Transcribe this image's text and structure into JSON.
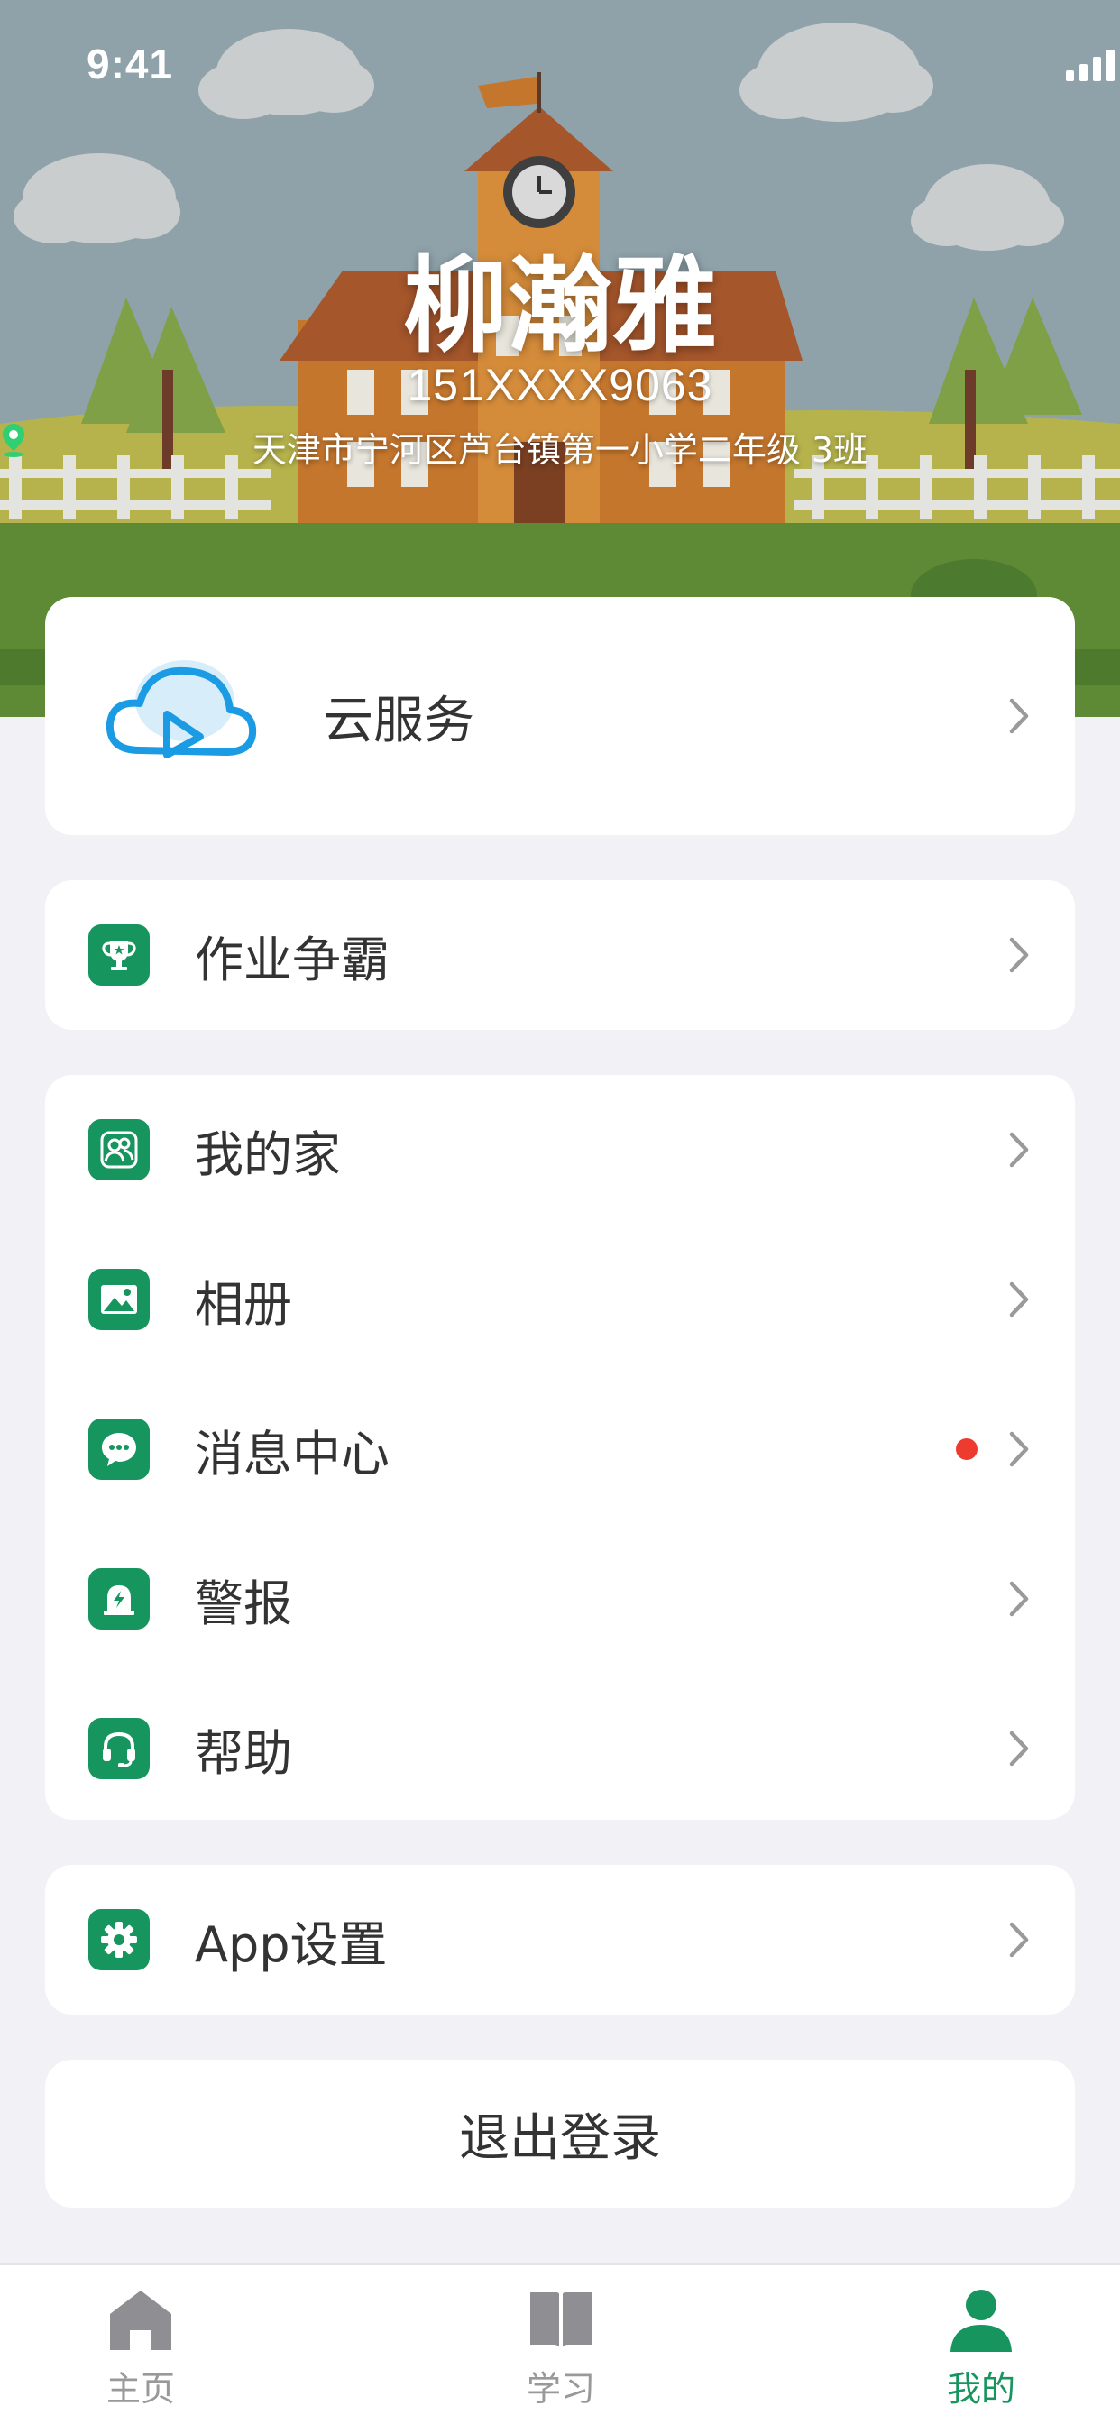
{
  "status_bar": {
    "time": "9:41"
  },
  "profile": {
    "name": "柳瀚雅",
    "phone": "151XXXX9063",
    "school": "天津市宁河区芦台镇第一小学二年级 3班"
  },
  "menu": {
    "cloud": {
      "label": "云服务",
      "icon": "cloud-play-icon"
    },
    "homework": {
      "label": "作业争霸",
      "icon": "trophy-icon"
    },
    "group": [
      {
        "label": "我的家",
        "icon": "family-icon"
      },
      {
        "label": "相册",
        "icon": "photo-icon"
      },
      {
        "label": "消息中心",
        "icon": "message-icon",
        "badge": "red-dot"
      },
      {
        "label": "警报",
        "icon": "alarm-icon"
      },
      {
        "label": "帮助",
        "icon": "headset-icon"
      }
    ],
    "settings": {
      "label": "App设置",
      "icon": "gear-icon"
    },
    "logout": {
      "label": "退出登录"
    }
  },
  "tabbar": {
    "tabs": [
      {
        "label": "主页",
        "icon": "home-icon",
        "active": false
      },
      {
        "label": "学习",
        "icon": "book-icon",
        "active": false
      },
      {
        "label": "我的",
        "icon": "person-icon",
        "active": true
      }
    ]
  },
  "colors": {
    "accent": "#17955e",
    "badge": "#ee3b2f",
    "page_bg": "#f2f2f6",
    "sky": "#8fa2aa"
  }
}
